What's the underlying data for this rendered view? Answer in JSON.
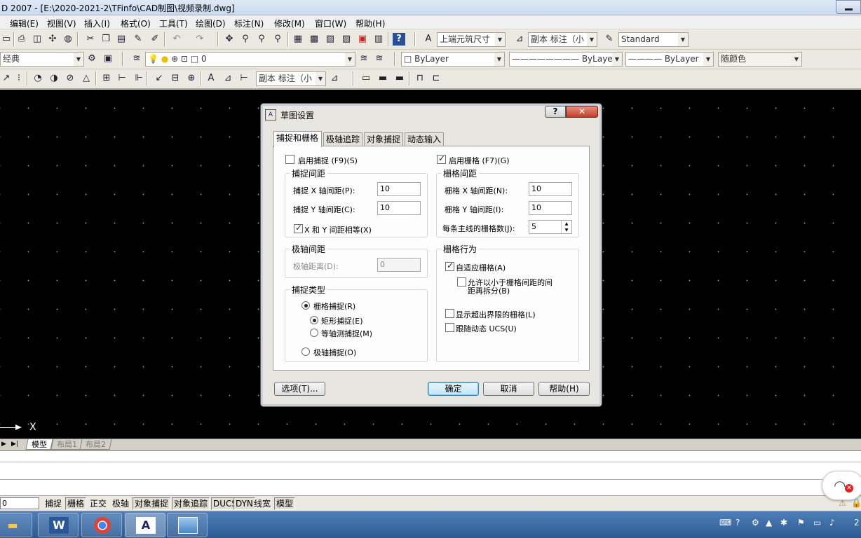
{
  "app": {
    "title": "D 2007 - [E:\\2020-2021-2\\TFinfo\\CAD制图\\视频录制.dwg]"
  },
  "menu": [
    "编辑(E)",
    "视图(V)",
    "插入(I)",
    "格式(O)",
    "工具(T)",
    "绘图(D)",
    "标注(N)",
    "修改(M)",
    "窗口(W)",
    "帮助(H)"
  ],
  "toolbar": {
    "dimstyle_combo": "上端元筑尺寸",
    "annot_combo1": "副本 标注（小",
    "textstyle_combo": "Standard",
    "workspace_combo": "经典",
    "layer_combo": "0",
    "color_combo": "ByLayer",
    "linetype_combo": "ByLayer",
    "lineweight_combo": "ByLayer",
    "plotstyle_combo": "随颜色",
    "annot_combo2": "副本 标注（小"
  },
  "canvas": {
    "ucs_label": "X"
  },
  "layout_tabs": [
    "模型",
    "布局1",
    "布局2"
  ],
  "status": {
    "coord": "0",
    "buttons": [
      "捕捉",
      "栅格",
      "正交",
      "极轴",
      "对象捕捉",
      "对象追踪",
      "DUCS",
      "DYN",
      "线宽",
      "模型"
    ],
    "on": [
      false,
      true,
      false,
      false,
      true,
      true,
      true,
      true,
      false,
      true
    ]
  },
  "dialog": {
    "title": "草图设置",
    "help_glyph": "?",
    "close_glyph": "✕",
    "tabs": [
      "捕捉和栅格",
      "极轴追踪",
      "对象捕捉",
      "动态输入"
    ],
    "snap": {
      "enable_label": "启用捕捉 (F9)(S)",
      "spacing_legend": "捕捉间距",
      "x_label": "捕捉 X 轴间距(P):",
      "x_value": "10",
      "y_label": "捕捉 Y 轴间距(C):",
      "y_value": "10",
      "equal_label": "X 和 Y 间距相等(X)",
      "polar_legend": "极轴间距",
      "polar_label": "极轴距离(D):",
      "polar_value": "0",
      "type_legend": "捕捉类型",
      "grid_snap": "栅格捕捉(R)",
      "rect_snap": "矩形捕捉(E)",
      "iso_snap": "等轴测捕捉(M)",
      "polar_snap": "极轴捕捉(O)"
    },
    "grid": {
      "enable_label": "启用栅格 (F7)(G)",
      "spacing_legend": "栅格间距",
      "x_label": "栅格 X 轴间距(N):",
      "x_value": "10",
      "y_label": "栅格 Y 轴间距(I):",
      "y_value": "10",
      "major_label": "每条主线的栅格数(J):",
      "major_value": "5",
      "behavior_legend": "栅格行为",
      "adaptive": "自适应栅格(A)",
      "subdivide_line1": "允许以小于栅格间距的间",
      "subdivide_line2": "距再拆分(B)",
      "beyond_limits": "显示超出界限的栅格(L)",
      "follow_ucs": "跟随动态 UCS(U)"
    },
    "buttons": {
      "options": "选项(T)...",
      "ok": "确定",
      "cancel": "取消",
      "help": "帮助(H)"
    }
  },
  "taskbar": {
    "clock_fragment": "2"
  }
}
